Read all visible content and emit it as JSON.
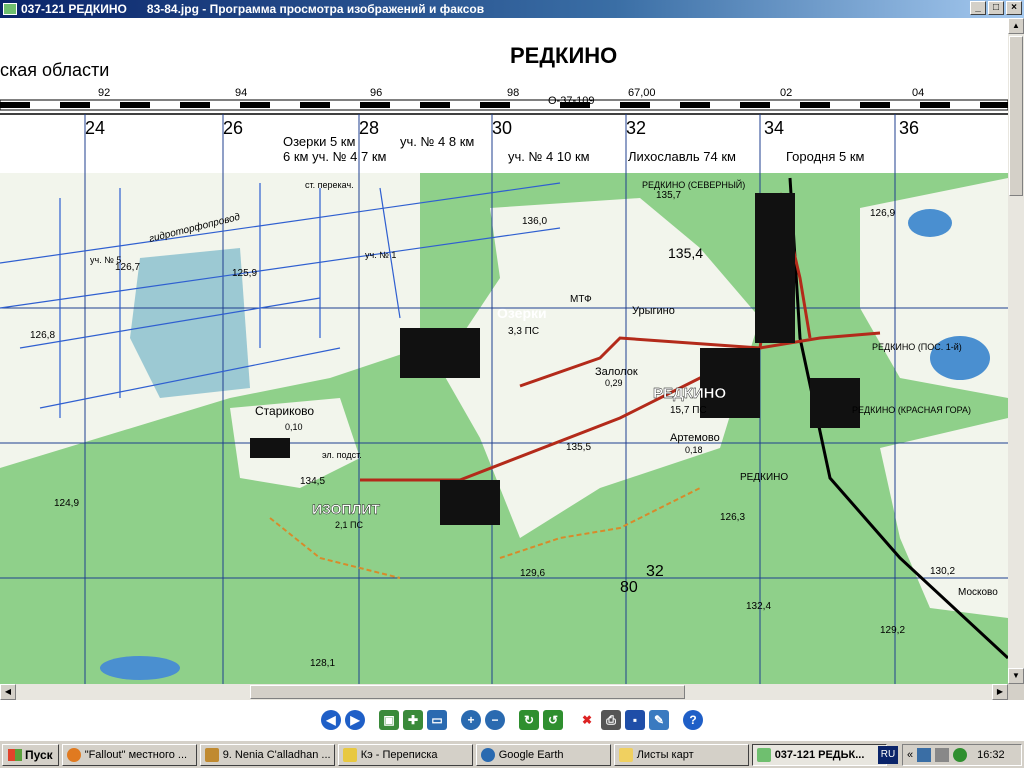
{
  "window": {
    "title_prefix": "037-121 РЕДКИНО",
    "title_file": "83-84.jpg - Программа просмотра изображений и факсов"
  },
  "map": {
    "sheet_title": "РЕДКИНО",
    "region": "ская области",
    "sheet_code": "О-37-109",
    "top_numbers": [
      "92",
      "94",
      "96",
      "98",
      "67,00",
      "02",
      "04"
    ],
    "grid_numbers": [
      "24",
      "26",
      "28",
      "30",
      "32",
      "34",
      "36"
    ],
    "directions": {
      "ozerki": "Озерки 5 км",
      "uch4_8": "уч. № 4 8 км",
      "uch4_7": "6 км уч. № 4 7 км",
      "uch4_10": "уч. № 4 10 км",
      "likhoslavl": "Лихославль 74 км",
      "gorodnya": "Городня 5 км"
    },
    "places": {
      "ozerki": "Озерки",
      "ozerki_info": "3,3 ПС",
      "redkino": "РЕДКИНО",
      "redkino_info": "15,7 ПС",
      "redkino_north": "РЕДКИНО (СЕВЕРНЫЙ)",
      "redkino_pos1": "РЕДКИНО (ПОС. 1-й)",
      "redkino_krasnaya": "РЕДКИНО (КРАСНАЯ ГОРА)",
      "redkino_station": "РЕДКИНО",
      "starikovo": "Стариково",
      "starikovo_info": "0,10",
      "zalog": "Залолок",
      "zalog_info": "0,29",
      "artemovo": "Артемово",
      "artemovo_info": "0,18",
      "izoplit": "ИЗОПЛИТ",
      "izoplit_info": "2,1 ПС",
      "mtf": "МТФ",
      "urygino": "Урыгино",
      "moskovo": "Москово",
      "gidroorofoprovod": "гидроторфопровод",
      "st_perekach": "ст. перекач.",
      "uch5": "уч. № 5",
      "uch1": "уч. № 1",
      "el_podst": "эл. подст."
    },
    "heights": [
      "126,7",
      "125,9",
      "126,8",
      "136,0",
      "135,7",
      "135,4",
      "126,9",
      "134,5",
      "135,5",
      "129,6",
      "124,9",
      "126,3",
      "132,4",
      "129,2",
      "130,2",
      "128,1",
      "80",
      "32"
    ]
  },
  "toolbar": {
    "buttons": [
      "prev-image",
      "next-image",
      "best-fit",
      "actual-size",
      "slideshow",
      "zoom-in",
      "zoom-out",
      "rotate-cw",
      "rotate-ccw",
      "delete",
      "print",
      "save",
      "open-editor",
      "help"
    ]
  },
  "taskbar": {
    "start_label": "Пуск",
    "tasks": [
      {
        "label": "\"Fallout\" местного ..."
      },
      {
        "label": "9. Nenia C'alladhan ..."
      },
      {
        "label": "Кэ - Переписка"
      },
      {
        "label": "Google Earth"
      },
      {
        "label": "Листы карт"
      },
      {
        "label": "037-121 РЕДЬК..."
      }
    ],
    "lang": "RU",
    "clock": "16:32"
  },
  "colors": {
    "map_green": "#8fd08a",
    "map_white": "#f4f6ee",
    "water_blue": "#6fa8dc",
    "road_red": "#b32a1a",
    "grid_blue": "#1f4ea8"
  }
}
